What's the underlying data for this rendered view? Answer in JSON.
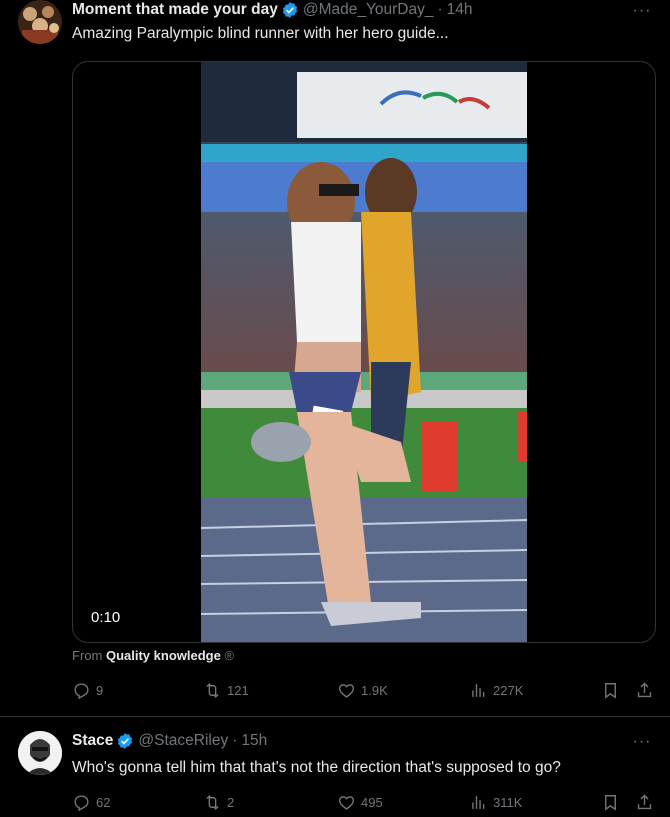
{
  "tweet1": {
    "display_name": "Moment that made your day",
    "handle": "@Made_YourDay_",
    "separator": "·",
    "time": "14h",
    "text": "Amazing Paralympic blind runner with her hero guide...",
    "video_duration": "0:10",
    "from_prefix": "From",
    "from_source": "Quality knowledge",
    "replies": "9",
    "retweets": "121",
    "likes": "1.9K",
    "views": "227K"
  },
  "tweet2": {
    "display_name": "Stace",
    "handle": "@StaceRiley",
    "separator": "·",
    "time": "15h",
    "text": "Who's gonna tell him that that's not the direction that's supposed to go?",
    "replies": "62",
    "retweets": "2",
    "likes": "495",
    "views": "311K"
  },
  "more_label": "···",
  "colors": {
    "verified": "#1d9bf0",
    "muted": "#71767b",
    "border": "#2f3336"
  },
  "icons": [
    "verified-badge-icon",
    "more-icon",
    "reply-icon",
    "retweet-icon",
    "like-icon",
    "views-icon",
    "bookmark-icon",
    "share-icon"
  ]
}
